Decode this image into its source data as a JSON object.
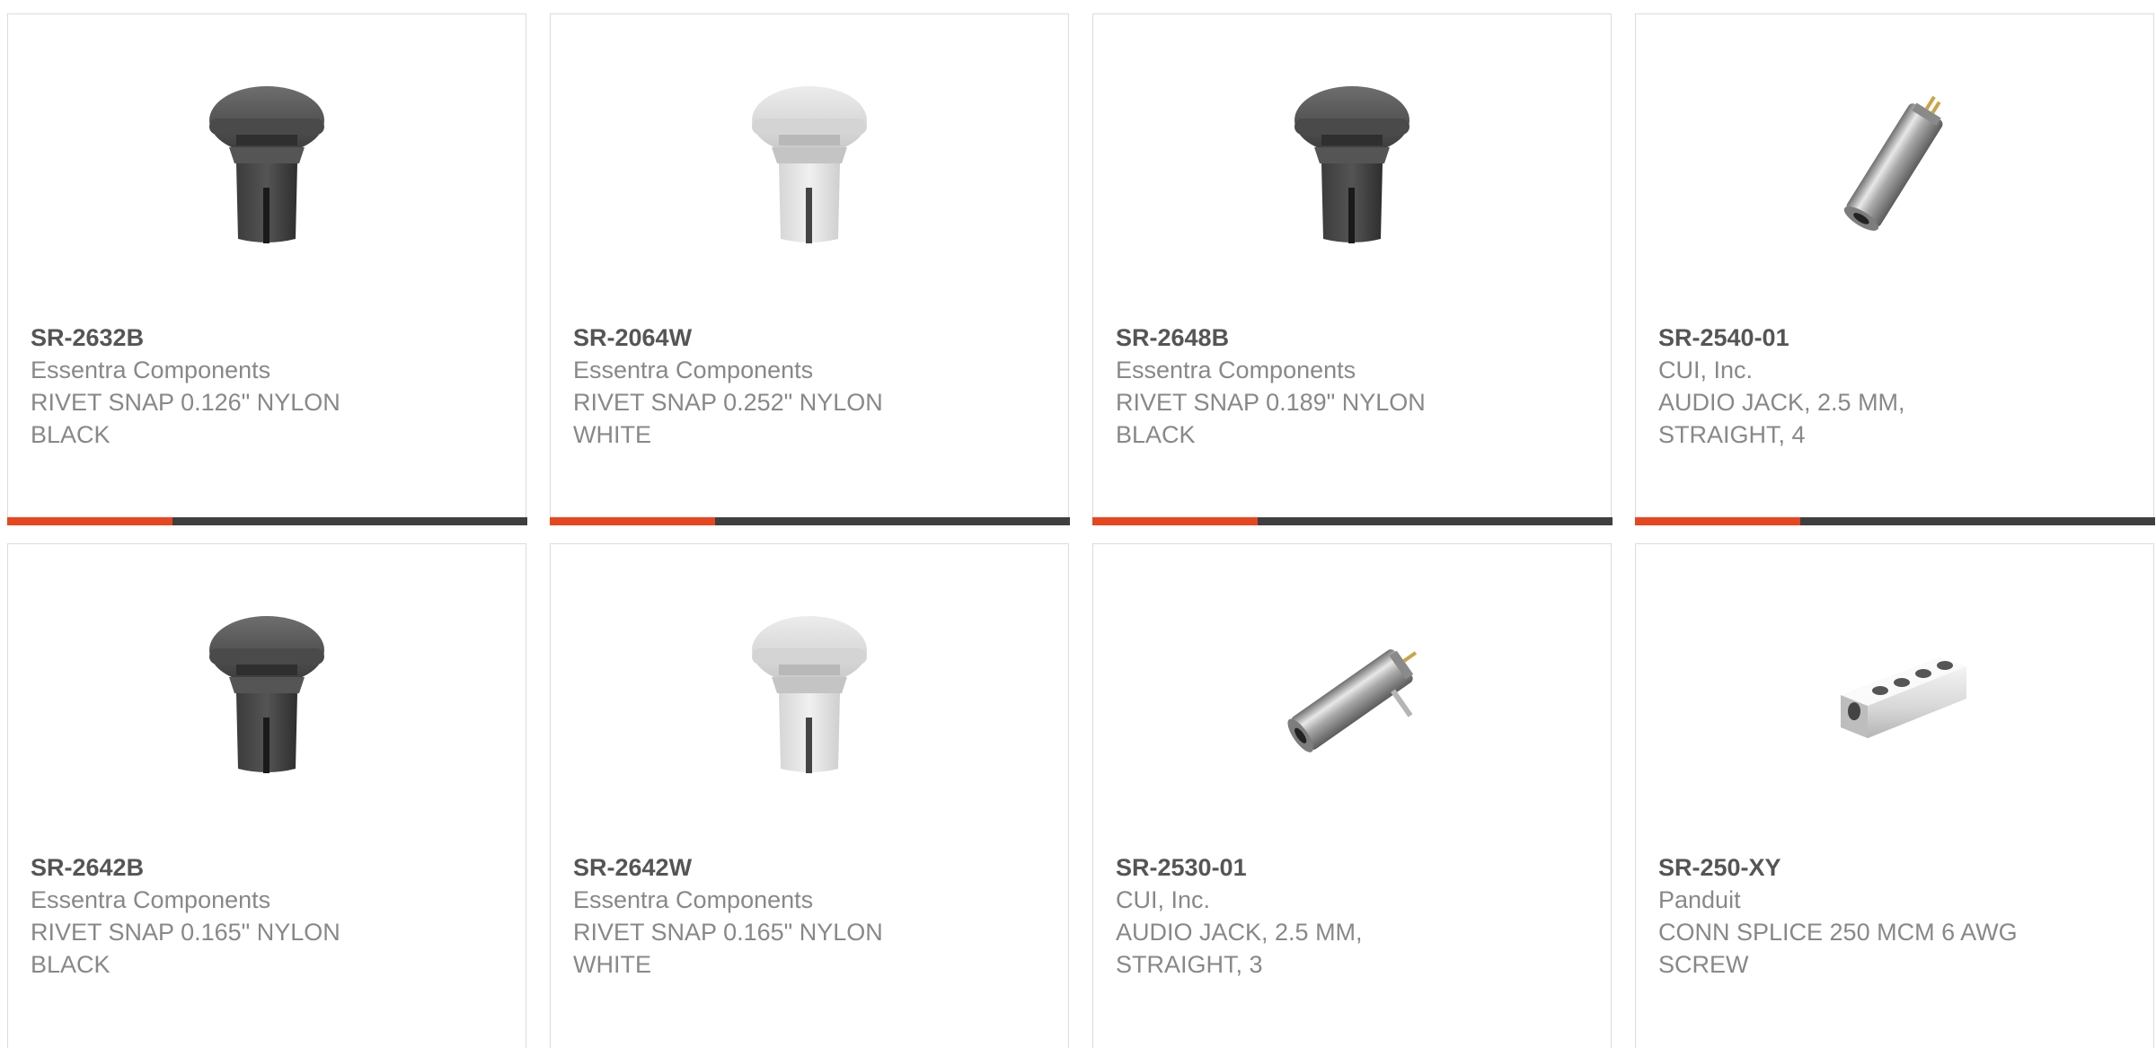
{
  "colors": {
    "accent": "#e8461f",
    "bar": "#3f3f3f",
    "border": "#dcdcdc",
    "part_number": "#555555",
    "text": "#888888"
  },
  "products": [
    {
      "part_number": "SR-2632B",
      "manufacturer": "Essentra Components",
      "description": "RIVET SNAP 0.126\" NYLON BLACK",
      "image_icon": "black-rivet-snap-image"
    },
    {
      "part_number": "SR-2064W",
      "manufacturer": "Essentra Components",
      "description": "RIVET SNAP 0.252\" NYLON WHITE",
      "image_icon": "white-rivet-snap-image"
    },
    {
      "part_number": "SR-2648B",
      "manufacturer": "Essentra Components",
      "description": "RIVET SNAP 0.189\" NYLON BLACK",
      "image_icon": "black-rivet-snap-image"
    },
    {
      "part_number": "SR-2540-01",
      "manufacturer": "CUI, Inc.",
      "description": "AUDIO JACK, 2.5 MM, STRAIGHT, 4",
      "image_icon": "audio-jack-image"
    },
    {
      "part_number": "SR-2642B",
      "manufacturer": "Essentra Components",
      "description": "RIVET SNAP 0.165\" NYLON BLACK",
      "image_icon": "black-rivet-snap-image"
    },
    {
      "part_number": "SR-2642W",
      "manufacturer": "Essentra Components",
      "description": "RIVET SNAP 0.165\" NYLON WHITE",
      "image_icon": "white-rivet-snap-image"
    },
    {
      "part_number": "SR-2530-01",
      "manufacturer": "CUI, Inc.",
      "description": "AUDIO JACK, 2.5 MM, STRAIGHT, 3",
      "image_icon": "audio-jack-image"
    },
    {
      "part_number": "SR-250-XY",
      "manufacturer": "Panduit",
      "description": "CONN SPLICE 250 MCM 6 AWG SCREW",
      "image_icon": "splice-connector-image"
    }
  ]
}
